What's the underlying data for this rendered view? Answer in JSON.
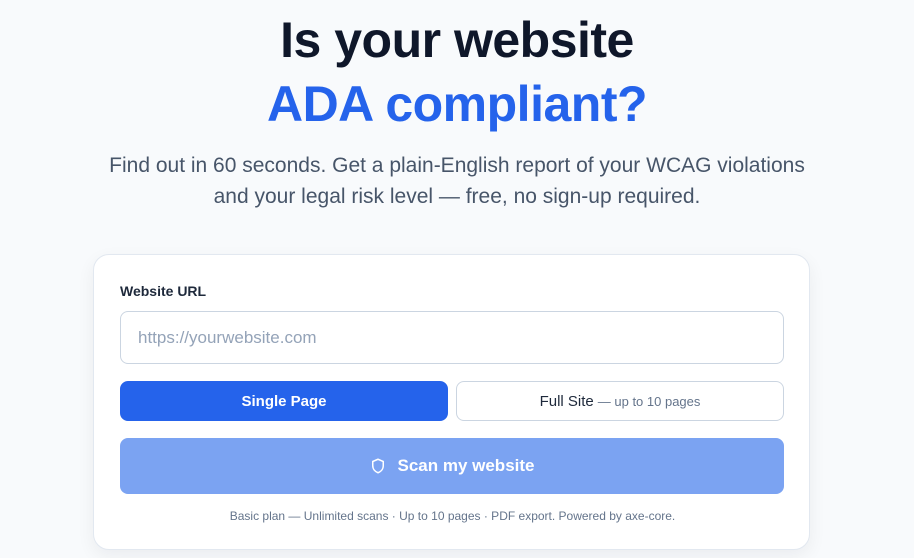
{
  "hero": {
    "title_line1": "Is your website",
    "title_line2": "ADA compliant?",
    "subtitle": "Find out in 60 seconds. Get a plain-English report of your WCAG violations and your legal risk level — free, no sign-up required."
  },
  "form": {
    "url_label": "Website URL",
    "url_placeholder": "https://yourwebsite.com",
    "url_value": "",
    "modes": {
      "single_label": "Single Page",
      "full_label": "Full Site",
      "full_note": "— up to 10 pages",
      "selected": "Single Page"
    },
    "scan_label": "Scan my website",
    "scan_icon": "shield-icon",
    "footnote": "Basic plan — Unlimited scans · Up to 10 pages · PDF export. Powered by axe-core."
  },
  "colors": {
    "accent": "#2563eb",
    "heading": "#0f172a",
    "scan_button_disabled": "#7ba3f2",
    "background": "#f8fafc"
  }
}
